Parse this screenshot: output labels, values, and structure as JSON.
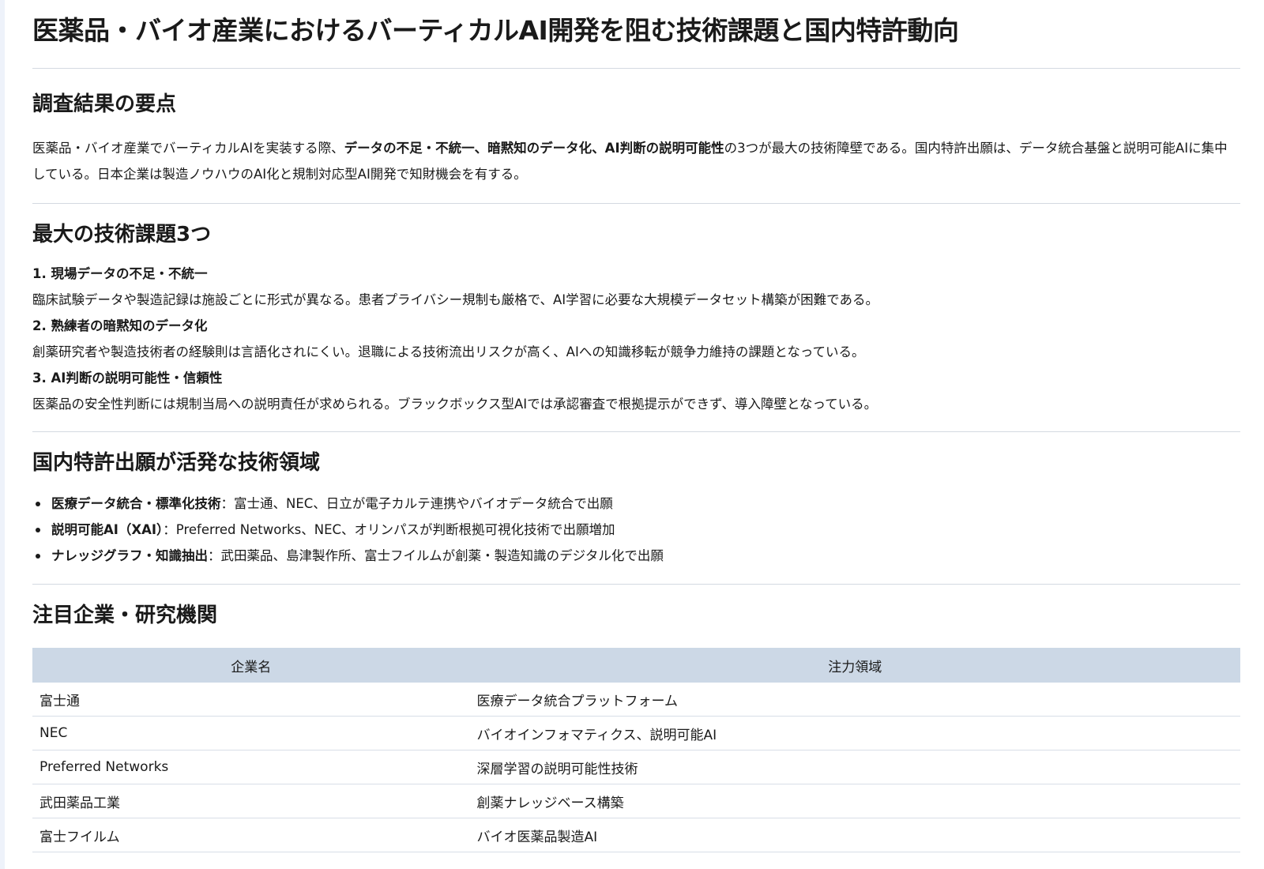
{
  "title": "医薬品・バイオ産業におけるバーティカルAI開発を阻む技術課題と国内特許動向",
  "summary": {
    "heading": "調査結果の要点",
    "text_1": "医薬品・バイオ産業でバーティカルAIを実装する際、",
    "bold": "データの不足・不統一、暗黙知のデータ化、AI判断の説明可能性",
    "text_2": "の3つが最大の技術障壁である。国内特許出願は、データ統合基盤と説明可能AIに集中している。日本企業は製造ノウハウのAI化と規制対応型AI開発で知財機会を有する。"
  },
  "challenges": {
    "heading": "最大の技術課題3つ",
    "items": [
      {
        "title": "1. 現場データの不足・不統一",
        "desc": "臨床試験データや製造記録は施設ごとに形式が異なる。患者プライバシー規制も厳格で、AI学習に必要な大規模データセット構築が困難である。"
      },
      {
        "title": "2. 熟練者の暗黙知のデータ化",
        "desc": "創薬研究者や製造技術者の経験則は言語化されにくい。退職による技術流出リスクが高く、AIへの知識移転が競争力維持の課題となっている。"
      },
      {
        "title": "3. AI判断の説明可能性・信頼性",
        "desc": "医薬品の安全性判断には規制当局への説明責任が求められる。ブラックボックス型AIでは承認審査で根拠提示ができず、導入障壁となっている。"
      }
    ]
  },
  "patents": {
    "heading": "国内特許出願が活発な技術領域",
    "items": [
      {
        "bold": "医療データ統合・標準化技術",
        "text": "：富士通、NEC、日立が電子カルテ連携やバイオデータ統合で出願"
      },
      {
        "bold": "説明可能AI（XAI）",
        "text": "：Preferred Networks、NEC、オリンパスが判断根拠可視化技術で出願増加"
      },
      {
        "bold": "ナレッジグラフ・知識抽出",
        "text": "：武田薬品、島津製作所、富士フイルムが創薬・製造知識のデジタル化で出願"
      }
    ]
  },
  "companies": {
    "heading": "注目企業・研究機関",
    "columns": [
      "企業名",
      "注力領域"
    ],
    "rows": [
      [
        "富士通",
        "医療データ統合プラットフォーム"
      ],
      [
        "NEC",
        "バイオインフォマティクス、説明可能AI"
      ],
      [
        "Preferred Networks",
        "深層学習の説明可能性技術"
      ],
      [
        "武田薬品工業",
        "創薬ナレッジベース構築"
      ],
      [
        "富士フイルム",
        "バイオ医薬品製造AI"
      ]
    ]
  }
}
